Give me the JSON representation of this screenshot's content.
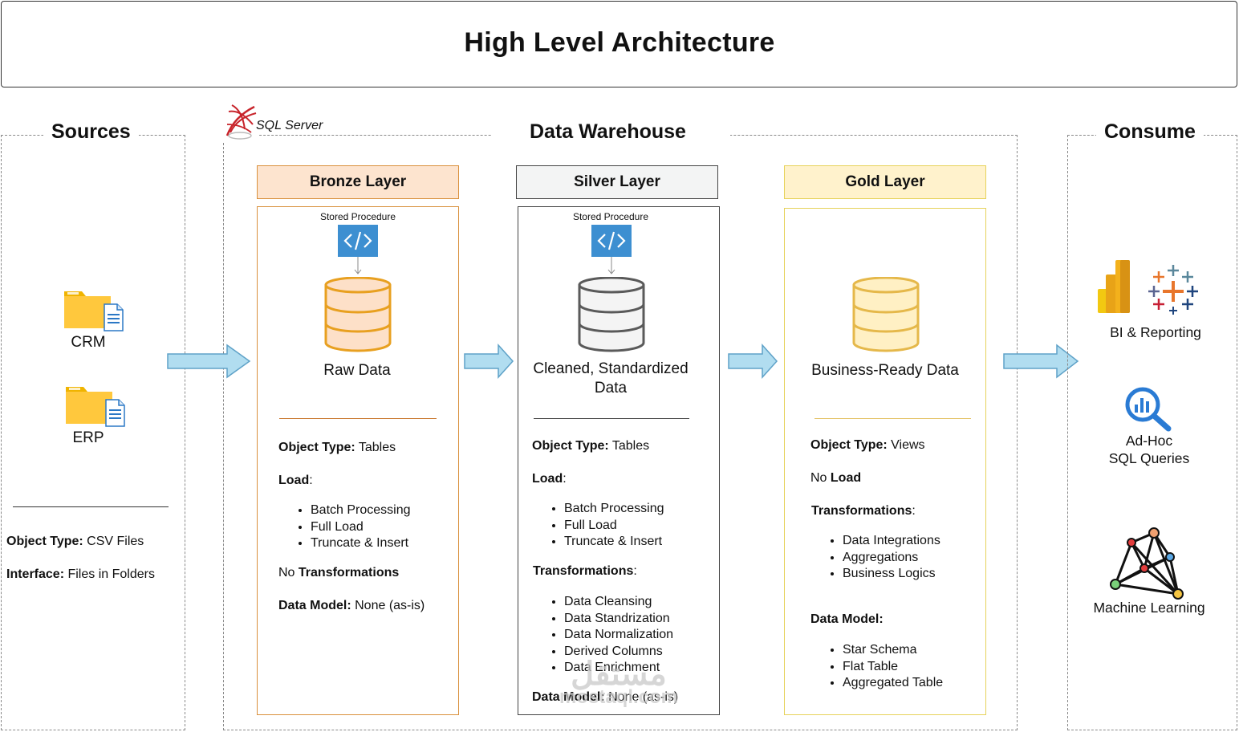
{
  "title": "High Level Architecture",
  "sources": {
    "title": "Sources",
    "items": [
      {
        "label": "CRM",
        "icon": "folder-file-icon"
      },
      {
        "label": "ERP",
        "icon": "folder-file-icon"
      }
    ],
    "object_type_label": "Object Type:",
    "object_type_value": " CSV Files",
    "interface_label": "Interface:",
    "interface_value": " Files in Folders"
  },
  "warehouse": {
    "title": "Data Warehouse",
    "platform_label": "SQL Server",
    "layers": [
      {
        "name": "Bronze Layer",
        "header_color": "#fde4cf",
        "border_color": "#d9903c",
        "db_fill": "#fde0c8",
        "db_stroke": "#e8a020",
        "stored_procedure": "Stored Procedure",
        "data_label": "Raw Data",
        "object_type_label": "Object Type:",
        "object_type_value": " Tables",
        "load_label": "Load",
        "load_suffix": ":",
        "load_items": [
          "Batch Processing",
          "Full Load",
          "Truncate & Insert"
        ],
        "transform_prefix": "No ",
        "transform_label": "Transformations",
        "data_model_label": "Data Model:",
        "data_model_value": " None (as-is)"
      },
      {
        "name": "Silver Layer",
        "header_color": "#f3f4f4",
        "border_color": "#444444",
        "db_fill": "#f4f4f4",
        "db_stroke": "#5a5a5a",
        "stored_procedure": "Stored Procedure",
        "data_label": "Cleaned, Standardized Data",
        "object_type_label": "Object Type:",
        "object_type_value": " Tables",
        "load_label": "Load",
        "load_suffix": ":",
        "load_items": [
          "Batch Processing",
          "Full Load",
          "Truncate & Insert"
        ],
        "transform_label": "Transformations",
        "transform_suffix": ":",
        "transform_items": [
          "Data Cleansing",
          "Data Standrization",
          "Data Normalization",
          "Derived Columns",
          "Data Enrichment"
        ],
        "data_model_label": "Data Model:",
        "data_model_value": " None (as-is)"
      },
      {
        "name": "Gold Layer",
        "header_color": "#fff2cc",
        "border_color": "#e6d25a",
        "db_fill": "#fff0c4",
        "db_stroke": "#e5b84a",
        "data_label": "Business-Ready Data",
        "object_type_label": "Object Type:",
        "object_type_value": " Views",
        "load_prefix": "No ",
        "load_label": "Load",
        "transform_label": "Transformations",
        "transform_suffix": ":",
        "transform_items": [
          "Data Integrations",
          "Aggregations",
          "Business Logics"
        ],
        "data_model_label": "Data Model:",
        "data_model_items": [
          "Star Schema",
          "Flat Table",
          "Aggregated Table"
        ]
      }
    ]
  },
  "consume": {
    "title": "Consume",
    "items": [
      {
        "label": "BI & Reporting",
        "icon": "powerbi-tableau-icon"
      },
      {
        "label": "Ad-Hoc SQL Queries",
        "line1": "Ad-Hoc",
        "line2": "SQL Queries",
        "icon": "analytics-search-icon"
      },
      {
        "label": "Machine Learning",
        "icon": "network-graph-icon"
      }
    ]
  },
  "watermark": {
    "line1": "مستقل",
    "line2": "mostaql.com"
  },
  "colors": {
    "arrow_fill": "#b1ddf0",
    "arrow_stroke": "#5fa2c8",
    "code_icon": "#3d8fd1"
  }
}
